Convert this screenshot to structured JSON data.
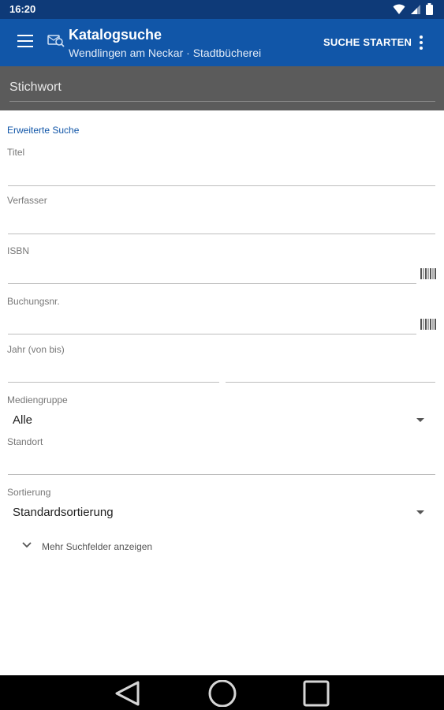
{
  "status_bar": {
    "time": "16:20"
  },
  "app_bar": {
    "title": "Katalogsuche",
    "subtitle": "Wendlingen am Neckar · Stadtbücherei",
    "action_label": "SUCHE STARTEN"
  },
  "keyword": {
    "placeholder": "Stichwort",
    "value": ""
  },
  "form": {
    "section_title": "Erweiterte Suche",
    "title_label": "Titel",
    "author_label": "Verfasser",
    "isbn_label": "ISBN",
    "booking_label": "Buchungsnr.",
    "year_label": "Jahr (von bis)",
    "media_group_label": "Mediengruppe",
    "media_group_value": "Alle",
    "location_label": "Standort",
    "sort_label": "Sortierung",
    "sort_value": "Standardsortierung",
    "more_fields_label": "Mehr Suchfelder anzeigen"
  },
  "colors": {
    "status_bar": "#0e3a78",
    "app_bar": "#1156a8",
    "keyword_bar": "#5b5b5b",
    "section_title": "#1156a8"
  },
  "icons": [
    "wifi-icon",
    "signal-icon",
    "battery-icon",
    "menu-icon",
    "catalog-icon",
    "overflow-icon",
    "barcode-icon",
    "chevron-down-icon",
    "nav-back-icon",
    "nav-home-icon",
    "nav-recents-icon"
  ]
}
